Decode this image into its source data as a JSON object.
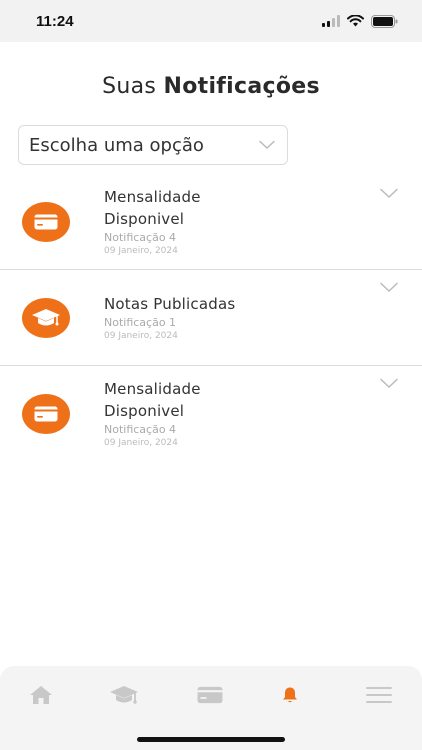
{
  "status_bar": {
    "time": "11:24"
  },
  "header": {
    "title_regular": "Suas ",
    "title_bold": "Notificações"
  },
  "filter": {
    "label": "Escolha uma opção"
  },
  "notifications": [
    {
      "title_line1": "Mensalidade",
      "title_line2": "Disponivel",
      "subtitle": "Notificação 4",
      "date": "09 Janeiro, 2024",
      "icon": "credit-card-icon"
    },
    {
      "title_line1": "Notas Publicadas",
      "title_line2": "",
      "subtitle": "Notificação 1",
      "date": "09 Janeiro, 2024",
      "icon": "graduation-cap-icon"
    },
    {
      "title_line1": "Mensalidade",
      "title_line2": "Disponivel",
      "subtitle": "Notificação 4",
      "date": "09 Janeiro, 2024",
      "icon": "credit-card-icon"
    }
  ],
  "tab_bar": {
    "items": [
      "home-icon",
      "graduation-cap-icon",
      "credit-card-icon",
      "bell-icon",
      "menu-icon"
    ],
    "active": "bell-icon"
  },
  "colors": {
    "accent": "#ee7119",
    "tab_inactive": "#c8c8c8"
  }
}
